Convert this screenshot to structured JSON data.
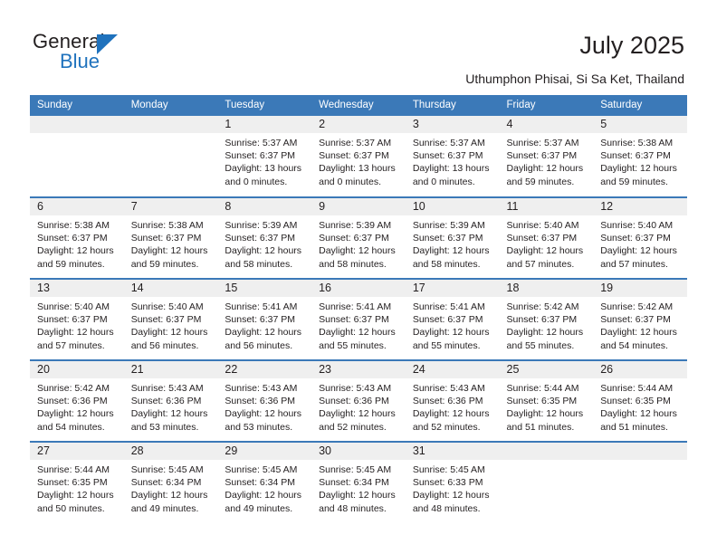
{
  "brand": {
    "name_part1": "General",
    "name_part2": "Blue",
    "triangle_icon": "triangle-icon",
    "accent_color": "#1f72bd"
  },
  "header": {
    "title": "July 2025",
    "subtitle": "Uthumphon Phisai, Si Sa Ket, Thailand"
  },
  "calendar": {
    "header_color": "#3b79b8",
    "daynum_bg": "#efefef",
    "weekdays": [
      "Sunday",
      "Monday",
      "Tuesday",
      "Wednesday",
      "Thursday",
      "Friday",
      "Saturday"
    ],
    "weeks": [
      [
        {
          "day": "",
          "empty": true
        },
        {
          "day": "",
          "empty": true
        },
        {
          "day": "1",
          "sunrise": "Sunrise: 5:37 AM",
          "sunset": "Sunset: 6:37 PM",
          "daylight": "Daylight: 13 hours and 0 minutes."
        },
        {
          "day": "2",
          "sunrise": "Sunrise: 5:37 AM",
          "sunset": "Sunset: 6:37 PM",
          "daylight": "Daylight: 13 hours and 0 minutes."
        },
        {
          "day": "3",
          "sunrise": "Sunrise: 5:37 AM",
          "sunset": "Sunset: 6:37 PM",
          "daylight": "Daylight: 13 hours and 0 minutes."
        },
        {
          "day": "4",
          "sunrise": "Sunrise: 5:37 AM",
          "sunset": "Sunset: 6:37 PM",
          "daylight": "Daylight: 12 hours and 59 minutes."
        },
        {
          "day": "5",
          "sunrise": "Sunrise: 5:38 AM",
          "sunset": "Sunset: 6:37 PM",
          "daylight": "Daylight: 12 hours and 59 minutes."
        }
      ],
      [
        {
          "day": "6",
          "sunrise": "Sunrise: 5:38 AM",
          "sunset": "Sunset: 6:37 PM",
          "daylight": "Daylight: 12 hours and 59 minutes."
        },
        {
          "day": "7",
          "sunrise": "Sunrise: 5:38 AM",
          "sunset": "Sunset: 6:37 PM",
          "daylight": "Daylight: 12 hours and 59 minutes."
        },
        {
          "day": "8",
          "sunrise": "Sunrise: 5:39 AM",
          "sunset": "Sunset: 6:37 PM",
          "daylight": "Daylight: 12 hours and 58 minutes."
        },
        {
          "day": "9",
          "sunrise": "Sunrise: 5:39 AM",
          "sunset": "Sunset: 6:37 PM",
          "daylight": "Daylight: 12 hours and 58 minutes."
        },
        {
          "day": "10",
          "sunrise": "Sunrise: 5:39 AM",
          "sunset": "Sunset: 6:37 PM",
          "daylight": "Daylight: 12 hours and 58 minutes."
        },
        {
          "day": "11",
          "sunrise": "Sunrise: 5:40 AM",
          "sunset": "Sunset: 6:37 PM",
          "daylight": "Daylight: 12 hours and 57 minutes."
        },
        {
          "day": "12",
          "sunrise": "Sunrise: 5:40 AM",
          "sunset": "Sunset: 6:37 PM",
          "daylight": "Daylight: 12 hours and 57 minutes."
        }
      ],
      [
        {
          "day": "13",
          "sunrise": "Sunrise: 5:40 AM",
          "sunset": "Sunset: 6:37 PM",
          "daylight": "Daylight: 12 hours and 57 minutes."
        },
        {
          "day": "14",
          "sunrise": "Sunrise: 5:40 AM",
          "sunset": "Sunset: 6:37 PM",
          "daylight": "Daylight: 12 hours and 56 minutes."
        },
        {
          "day": "15",
          "sunrise": "Sunrise: 5:41 AM",
          "sunset": "Sunset: 6:37 PM",
          "daylight": "Daylight: 12 hours and 56 minutes."
        },
        {
          "day": "16",
          "sunrise": "Sunrise: 5:41 AM",
          "sunset": "Sunset: 6:37 PM",
          "daylight": "Daylight: 12 hours and 55 minutes."
        },
        {
          "day": "17",
          "sunrise": "Sunrise: 5:41 AM",
          "sunset": "Sunset: 6:37 PM",
          "daylight": "Daylight: 12 hours and 55 minutes."
        },
        {
          "day": "18",
          "sunrise": "Sunrise: 5:42 AM",
          "sunset": "Sunset: 6:37 PM",
          "daylight": "Daylight: 12 hours and 55 minutes."
        },
        {
          "day": "19",
          "sunrise": "Sunrise: 5:42 AM",
          "sunset": "Sunset: 6:37 PM",
          "daylight": "Daylight: 12 hours and 54 minutes."
        }
      ],
      [
        {
          "day": "20",
          "sunrise": "Sunrise: 5:42 AM",
          "sunset": "Sunset: 6:36 PM",
          "daylight": "Daylight: 12 hours and 54 minutes."
        },
        {
          "day": "21",
          "sunrise": "Sunrise: 5:43 AM",
          "sunset": "Sunset: 6:36 PM",
          "daylight": "Daylight: 12 hours and 53 minutes."
        },
        {
          "day": "22",
          "sunrise": "Sunrise: 5:43 AM",
          "sunset": "Sunset: 6:36 PM",
          "daylight": "Daylight: 12 hours and 53 minutes."
        },
        {
          "day": "23",
          "sunrise": "Sunrise: 5:43 AM",
          "sunset": "Sunset: 6:36 PM",
          "daylight": "Daylight: 12 hours and 52 minutes."
        },
        {
          "day": "24",
          "sunrise": "Sunrise: 5:43 AM",
          "sunset": "Sunset: 6:36 PM",
          "daylight": "Daylight: 12 hours and 52 minutes."
        },
        {
          "day": "25",
          "sunrise": "Sunrise: 5:44 AM",
          "sunset": "Sunset: 6:35 PM",
          "daylight": "Daylight: 12 hours and 51 minutes."
        },
        {
          "day": "26",
          "sunrise": "Sunrise: 5:44 AM",
          "sunset": "Sunset: 6:35 PM",
          "daylight": "Daylight: 12 hours and 51 minutes."
        }
      ],
      [
        {
          "day": "27",
          "sunrise": "Sunrise: 5:44 AM",
          "sunset": "Sunset: 6:35 PM",
          "daylight": "Daylight: 12 hours and 50 minutes."
        },
        {
          "day": "28",
          "sunrise": "Sunrise: 5:45 AM",
          "sunset": "Sunset: 6:34 PM",
          "daylight": "Daylight: 12 hours and 49 minutes."
        },
        {
          "day": "29",
          "sunrise": "Sunrise: 5:45 AM",
          "sunset": "Sunset: 6:34 PM",
          "daylight": "Daylight: 12 hours and 49 minutes."
        },
        {
          "day": "30",
          "sunrise": "Sunrise: 5:45 AM",
          "sunset": "Sunset: 6:34 PM",
          "daylight": "Daylight: 12 hours and 48 minutes."
        },
        {
          "day": "31",
          "sunrise": "Sunrise: 5:45 AM",
          "sunset": "Sunset: 6:33 PM",
          "daylight": "Daylight: 12 hours and 48 minutes."
        },
        {
          "day": "",
          "empty": true
        },
        {
          "day": "",
          "empty": true
        }
      ]
    ]
  }
}
